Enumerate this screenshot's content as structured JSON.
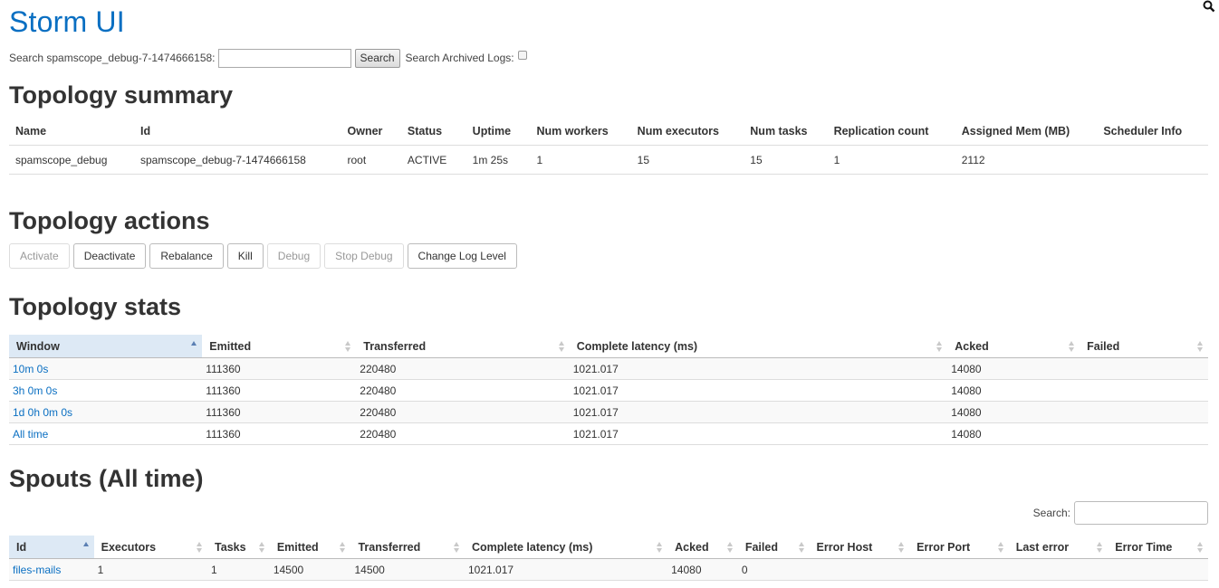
{
  "app_title": "Storm UI",
  "search": {
    "label": "Search spamscope_debug-7-1474666158:",
    "input_value": "",
    "button": "Search",
    "archived_label": "Search Archived Logs:"
  },
  "topology_summary": {
    "heading": "Topology summary",
    "columns": [
      "Name",
      "Id",
      "Owner",
      "Status",
      "Uptime",
      "Num workers",
      "Num executors",
      "Num tasks",
      "Replication count",
      "Assigned Mem (MB)",
      "Scheduler Info"
    ],
    "row": [
      "spamscope_debug",
      "spamscope_debug-7-1474666158",
      "root",
      "ACTIVE",
      "1m 25s",
      "1",
      "15",
      "15",
      "1",
      "2112",
      ""
    ]
  },
  "topology_actions": {
    "heading": "Topology actions",
    "buttons": [
      {
        "label": "Activate",
        "enabled": false
      },
      {
        "label": "Deactivate",
        "enabled": true
      },
      {
        "label": "Rebalance",
        "enabled": true
      },
      {
        "label": "Kill",
        "enabled": true
      },
      {
        "label": "Debug",
        "enabled": false
      },
      {
        "label": "Stop Debug",
        "enabled": false
      },
      {
        "label": "Change Log Level",
        "enabled": true
      }
    ]
  },
  "topology_stats": {
    "heading": "Topology stats",
    "columns": [
      "Window",
      "Emitted",
      "Transferred",
      "Complete latency (ms)",
      "Acked",
      "Failed"
    ],
    "rows": [
      [
        "10m 0s",
        "111360",
        "220480",
        "1021.017",
        "14080",
        ""
      ],
      [
        "3h 0m 0s",
        "111360",
        "220480",
        "1021.017",
        "14080",
        ""
      ],
      [
        "1d 0h 0m 0s",
        "111360",
        "220480",
        "1021.017",
        "14080",
        ""
      ],
      [
        "All time",
        "111360",
        "220480",
        "1021.017",
        "14080",
        ""
      ]
    ]
  },
  "spouts": {
    "heading": "Spouts (All time)",
    "search_label": "Search:",
    "search_value": "",
    "columns": [
      "Id",
      "Executors",
      "Tasks",
      "Emitted",
      "Transferred",
      "Complete latency (ms)",
      "Acked",
      "Failed",
      "Error Host",
      "Error Port",
      "Last error",
      "Error Time"
    ],
    "rows": [
      [
        "files-mails",
        "1",
        "1",
        "14500",
        "14500",
        "1021.017",
        "14080",
        "0",
        "",
        "",
        "",
        ""
      ]
    ]
  },
  "colors": {
    "link": "#0a6fc2",
    "title": "#0a6fc2",
    "sorted_header": "#dde9f5"
  }
}
